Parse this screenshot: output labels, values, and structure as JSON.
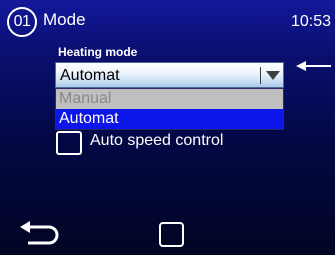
{
  "header": {
    "screen_number": "01",
    "title": "Mode",
    "time": "10:53"
  },
  "heating_mode": {
    "label": "Heating mode",
    "selected": "Automat",
    "options": [
      {
        "label": "Manual",
        "state": "disabled"
      },
      {
        "label": "Automat",
        "state": "highlighted"
      }
    ]
  },
  "auto_speed_control": {
    "label": "Auto speed control",
    "checked": false
  },
  "footer": {
    "back_icon": "back-arrow-icon",
    "home_icon": "home-square-icon"
  },
  "colors": {
    "background": "#0a0f6e",
    "highlight": "#0d16e8",
    "disabled_option": "#bfbfbf"
  }
}
